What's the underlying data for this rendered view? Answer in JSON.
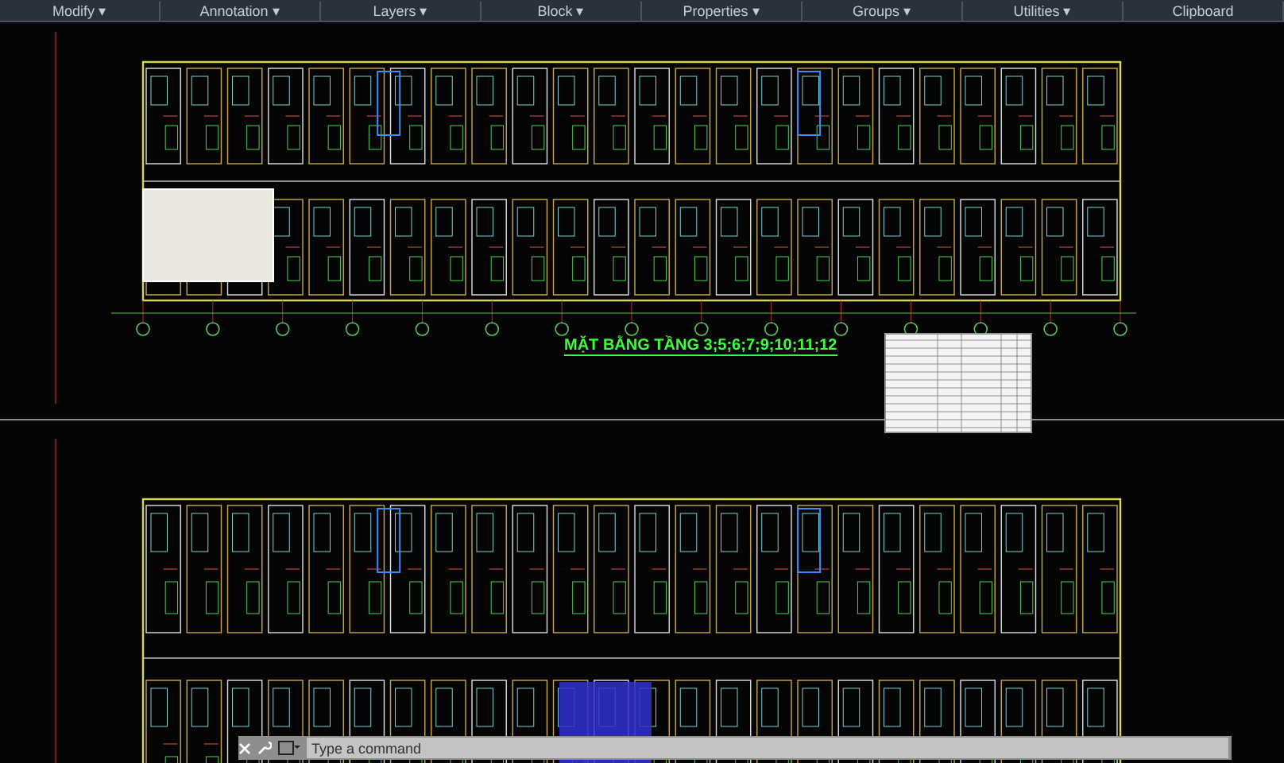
{
  "ribbon": {
    "panels": [
      "Modify ▾",
      "Annotation ▾",
      "Layers ▾",
      "Block ▾",
      "Properties ▾",
      "Groups ▾",
      "Utilities ▾",
      "Clipboard"
    ]
  },
  "drawing": {
    "title": "MẶT BẰNG TẦNG 3;5;6;7;9;10;11;12"
  },
  "command_line": {
    "placeholder": "Type a command"
  }
}
